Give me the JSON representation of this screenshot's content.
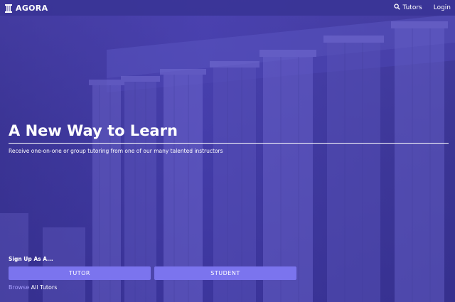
{
  "nav": {
    "brand": "AGORA",
    "tutors_label": "Tutors",
    "login_label": "Login"
  },
  "hero": {
    "title": "A New Way to Learn",
    "subtitle": "Receive one-on-one or group tutoring from one of our many talented instructors"
  },
  "signup": {
    "label": "Sign Up As A...",
    "tutor_button": "TUTOR",
    "student_button": "STUDENT"
  },
  "browse": {
    "link": "Browse",
    "rest": " All Tutors"
  },
  "colors": {
    "nav_bg": "#3a3496",
    "button_bg": "#7b74ee",
    "link": "#a79fff",
    "overlay": "#4a43b0"
  },
  "icons": {
    "brand": "column-icon",
    "tutors": "search-icon"
  }
}
